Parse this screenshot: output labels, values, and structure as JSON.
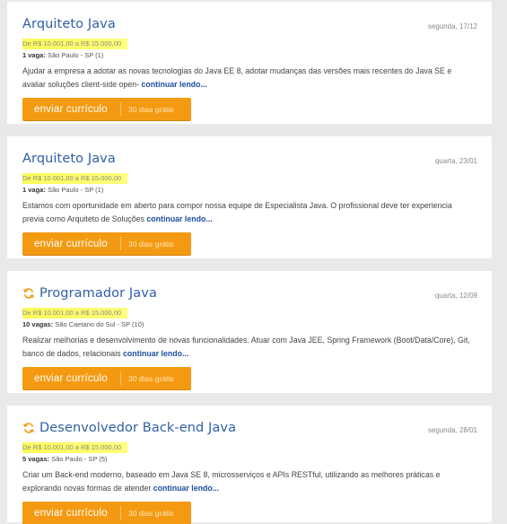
{
  "jobs": [
    {
      "title": "Arquiteto Java",
      "date": "segunda, 17/12",
      "salary": "De R$ 10.001,00 a R$ 15.000,00",
      "vagas_label": "1 vaga:",
      "location": "São Paulo - SP (1)",
      "description": "Ajudar a empresa a adotar as novas tecnologias do Java EE 8, adotar mudanças das versões mais recentes do Java SE e avaliar soluções client-side open-",
      "more": "continuar lendo...",
      "button": "enviar currículo",
      "trial": "30 dias grátis",
      "refresh_icon": false
    },
    {
      "title": "Arquiteto Java",
      "date": "quarta, 23/01",
      "salary": "De R$ 10.001,00 a R$ 15.000,00",
      "vagas_label": "1 vaga:",
      "location": "São Paulo - SP (1)",
      "description": "Estamos com oportunidade em aberto para compor nossa equipe de Especialista Java. O profissional deve ter experiencia previa como Arquiteto de Soluções",
      "more": "continuar lendo...",
      "button": "enviar currículo",
      "trial": "30 dias grátis",
      "refresh_icon": false
    },
    {
      "title": "Programador Java",
      "date": "quarta, 12/09",
      "salary": "De R$ 10.001,00 a R$ 15.000,00",
      "vagas_label": "10 vagas:",
      "location": "São Caetano do Sul - SP (10)",
      "description": "Realizar melhorias e desenvolvimento de novas funcionalidades. Atuar com Java JEE, Spring Framework (Boot/Data/Core), Git, banco de dados, relacionais",
      "more": "continuar lendo...",
      "button": "enviar currículo",
      "trial": "30 dias grátis",
      "refresh_icon": true
    },
    {
      "title": "Desenvolvedor Back-end Java",
      "date": "segunda, 28/01",
      "salary": "De R$ 10.001,00 a R$ 15.000,00",
      "vagas_label": "5 vagas:",
      "location": "São Paulo - SP (5)",
      "description": "Criar um Back-end moderno, baseado em Java SE 8, microsserviços e APIs RESTful, utilizando as melhores práticas e explorando novas formas de atender",
      "more": "continuar lendo...",
      "button": "enviar currículo",
      "trial": "30 dias grátis",
      "refresh_icon": true
    }
  ],
  "colors": {
    "title": "#2f5fa6",
    "button": "#f49a12",
    "highlight": "#fbfb5a",
    "link": "#1c4fa0",
    "refresh_icon": "#f49a12"
  }
}
